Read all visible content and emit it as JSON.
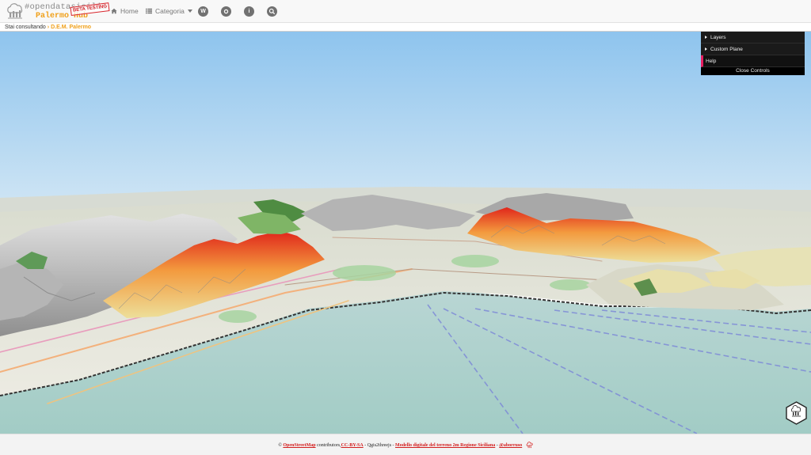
{
  "brand": {
    "title": "#opendatasicilia",
    "subtitle": "Palermo Hub",
    "badge": "BETA TESTING"
  },
  "nav": {
    "home": "Home",
    "category": "Categoria",
    "icons": [
      "wikipedia-icon",
      "github-icon",
      "info-icon",
      "search-icon"
    ],
    "wikipedia_glyph": "W",
    "info_glyph": "i"
  },
  "breadcrumb": {
    "prefix": "Stai consultando",
    "current": "D.E.M. Palermo"
  },
  "controls": {
    "layers": "Layers",
    "custom_plane": "Custom Plane",
    "help": "Help",
    "close": "Close Controls"
  },
  "footer": {
    "copy": "©",
    "osm": "OpenStreetMap",
    "contributors": "contributors,",
    "license": "CC-BY-SA",
    "dash1": "-",
    "qgis": "Qgis2threejs",
    "dash2": "-",
    "dem": "Modello digitale del terreno 2m Regione Siciliana",
    "dash3": "-",
    "author": "@aborruso"
  },
  "colors": {
    "accent": "#f0a01a",
    "link": "#d31d1d",
    "sky": "#a6cff0",
    "sea": "#a9cfc9",
    "hill_red": "#e23220"
  }
}
